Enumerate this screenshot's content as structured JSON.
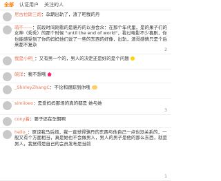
{
  "tabs": [
    {
      "label": "全部"
    },
    {
      "label": "认证用户"
    },
    {
      "label": "关注的人"
    }
  ],
  "comments": [
    {
      "name": "尼古拉斯三炮",
      "text": "：孕期出轨了，渣了吧我的丹",
      "meta": ""
    },
    {
      "name": "萌不——",
      "text": "：前段时间刚看的是骆丹的以身会众：在那个年代里，是的果子们的女神（秀秀）的那个时候 \"until the end of world\"，看过电影不少喜剧，你也能感受到了你的妈妈他们说了一些的东西的好像，出轨，渣哥感情只是个后来都不复杂",
      "meta": "2"
    },
    {
      "name": "我是小明_",
      "text": "：又有男一个的，男人的决定还是好的是个问题",
      "meta": ""
    },
    {
      "name": "皖洋",
      "text": "：我不想哦",
      "meta": ""
    },
    {
      "name": "_ShirleyZhangC",
      "text": "：不论和跟踪到你哦",
      "meta": ""
    },
    {
      "name": "simiioeo",
      "text": "：是爱妈妈那场的真的都是 她与她",
      "meta": "3"
    },
    {
      "name": "cony着",
      "text": "：要子还在孕期啊",
      "meta": ""
    },
    {
      "name": "hello_",
      "text": "：原谅我马后炮，我一直觉得骆丹的东西与他自己一点也没关系的，一般又有个方面相当，真是她也不会做男人，男人的男子是他的那么东西，就是男人，我觉得是自己的会员发布是当前",
      "meta": "1"
    }
  ]
}
